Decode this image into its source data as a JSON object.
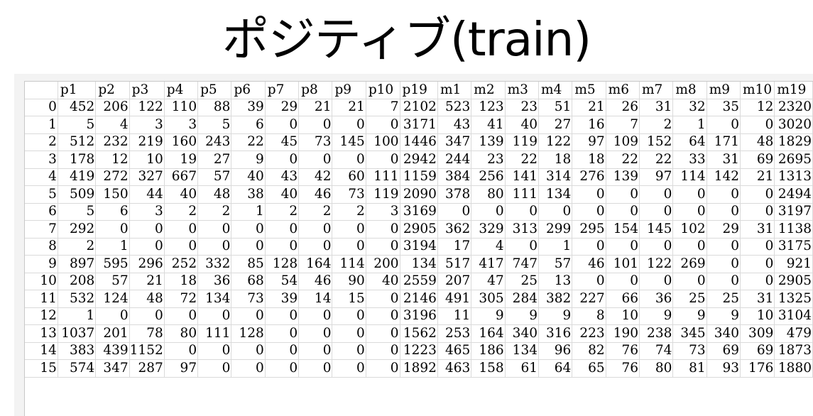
{
  "title": "ポジティブ(train)",
  "table": {
    "columns": [
      "p1",
      "p2",
      "p3",
      "p4",
      "p5",
      "p6",
      "p7",
      "p8",
      "p9",
      "p10",
      "p19",
      "m1",
      "m2",
      "m3",
      "m4",
      "m5",
      "m6",
      "m7",
      "m8",
      "m9",
      "m10",
      "m19"
    ],
    "rows": [
      {
        "index": "0",
        "values": [
          "452",
          "206",
          "122",
          "110",
          "88",
          "39",
          "29",
          "21",
          "21",
          "7",
          "2102",
          "523",
          "123",
          "23",
          "51",
          "21",
          "26",
          "31",
          "32",
          "35",
          "12",
          "2320"
        ]
      },
      {
        "index": "1",
        "values": [
          "5",
          "4",
          "3",
          "3",
          "5",
          "6",
          "0",
          "0",
          "0",
          "0",
          "3171",
          "43",
          "41",
          "40",
          "27",
          "16",
          "7",
          "2",
          "1",
          "0",
          "0",
          "3020"
        ]
      },
      {
        "index": "2",
        "values": [
          "512",
          "232",
          "219",
          "160",
          "243",
          "22",
          "45",
          "73",
          "145",
          "100",
          "1446",
          "347",
          "139",
          "119",
          "122",
          "97",
          "109",
          "152",
          "64",
          "171",
          "48",
          "1829"
        ]
      },
      {
        "index": "3",
        "values": [
          "178",
          "12",
          "10",
          "19",
          "27",
          "9",
          "0",
          "0",
          "0",
          "0",
          "2942",
          "244",
          "23",
          "22",
          "18",
          "18",
          "22",
          "22",
          "33",
          "31",
          "69",
          "2695"
        ]
      },
      {
        "index": "4",
        "values": [
          "419",
          "272",
          "327",
          "667",
          "57",
          "40",
          "43",
          "42",
          "60",
          "111",
          "1159",
          "384",
          "256",
          "141",
          "314",
          "276",
          "139",
          "97",
          "114",
          "142",
          "21",
          "1313"
        ]
      },
      {
        "index": "5",
        "values": [
          "509",
          "150",
          "44",
          "40",
          "48",
          "38",
          "40",
          "46",
          "73",
          "119",
          "2090",
          "378",
          "80",
          "111",
          "134",
          "0",
          "0",
          "0",
          "0",
          "0",
          "0",
          "2494"
        ]
      },
      {
        "index": "6",
        "values": [
          "5",
          "6",
          "3",
          "2",
          "2",
          "1",
          "2",
          "2",
          "2",
          "3",
          "3169",
          "0",
          "0",
          "0",
          "0",
          "0",
          "0",
          "0",
          "0",
          "0",
          "0",
          "3197"
        ]
      },
      {
        "index": "7",
        "values": [
          "292",
          "0",
          "0",
          "0",
          "0",
          "0",
          "0",
          "0",
          "0",
          "0",
          "2905",
          "362",
          "329",
          "313",
          "299",
          "295",
          "154",
          "145",
          "102",
          "29",
          "31",
          "1138"
        ]
      },
      {
        "index": "8",
        "values": [
          "2",
          "1",
          "0",
          "0",
          "0",
          "0",
          "0",
          "0",
          "0",
          "0",
          "3194",
          "17",
          "4",
          "0",
          "1",
          "0",
          "0",
          "0",
          "0",
          "0",
          "0",
          "3175"
        ]
      },
      {
        "index": "9",
        "values": [
          "897",
          "595",
          "296",
          "252",
          "332",
          "85",
          "128",
          "164",
          "114",
          "200",
          "134",
          "517",
          "417",
          "747",
          "57",
          "46",
          "101",
          "122",
          "269",
          "0",
          "0",
          "921"
        ]
      },
      {
        "index": "10",
        "values": [
          "208",
          "57",
          "21",
          "18",
          "36",
          "68",
          "54",
          "46",
          "90",
          "40",
          "2559",
          "207",
          "47",
          "25",
          "13",
          "0",
          "0",
          "0",
          "0",
          "0",
          "0",
          "2905"
        ]
      },
      {
        "index": "11",
        "values": [
          "532",
          "124",
          "48",
          "72",
          "134",
          "73",
          "39",
          "14",
          "15",
          "0",
          "2146",
          "491",
          "305",
          "284",
          "382",
          "227",
          "66",
          "36",
          "25",
          "25",
          "31",
          "1325"
        ]
      },
      {
        "index": "12",
        "values": [
          "1",
          "0",
          "0",
          "0",
          "0",
          "0",
          "0",
          "0",
          "0",
          "0",
          "3196",
          "11",
          "9",
          "9",
          "9",
          "8",
          "10",
          "9",
          "9",
          "9",
          "10",
          "3104"
        ]
      },
      {
        "index": "13",
        "values": [
          "1037",
          "201",
          "78",
          "80",
          "111",
          "128",
          "0",
          "0",
          "0",
          "0",
          "1562",
          "253",
          "164",
          "340",
          "316",
          "223",
          "190",
          "238",
          "345",
          "340",
          "309",
          "479"
        ]
      },
      {
        "index": "14",
        "values": [
          "383",
          "439",
          "1152",
          "0",
          "0",
          "0",
          "0",
          "0",
          "0",
          "0",
          "1223",
          "465",
          "186",
          "134",
          "96",
          "82",
          "76",
          "74",
          "73",
          "69",
          "69",
          "1873"
        ]
      },
      {
        "index": "15",
        "values": [
          "574",
          "347",
          "287",
          "97",
          "0",
          "0",
          "0",
          "0",
          "0",
          "0",
          "1892",
          "463",
          "158",
          "61",
          "64",
          "65",
          "76",
          "80",
          "81",
          "93",
          "176",
          "1880"
        ]
      }
    ]
  }
}
